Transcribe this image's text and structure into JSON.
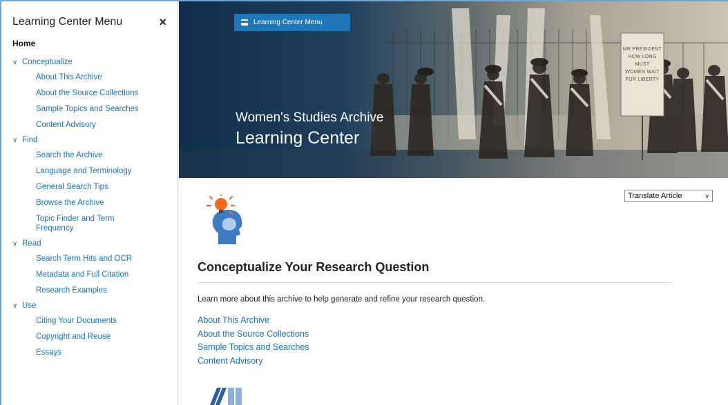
{
  "sidebar": {
    "title": "Learning Center Menu",
    "close_label": "×",
    "home_label": "Home",
    "sections": [
      {
        "label": "Conceptualize",
        "items": [
          "About This Archive",
          "About the Source Collections",
          "Sample Topics and Searches",
          "Content Advisory"
        ]
      },
      {
        "label": "Find",
        "items": [
          "Search the Archive",
          "Language and Terminology",
          "General Search Tips",
          "Browse the Archive",
          "Topic Finder and Term Frequency"
        ]
      },
      {
        "label": "Read",
        "items": [
          "Search Term Hits and OCR",
          "Metadata and Full Citation",
          "Research Examples"
        ]
      },
      {
        "label": "Use",
        "items": [
          "Citing Your Documents",
          "Copyright and Reuse",
          "Essays"
        ]
      }
    ]
  },
  "hero": {
    "menu_button_label": "Learning Center Menu",
    "subtitle": "Women's Studies Archive",
    "title": "Learning Center",
    "sign_text": [
      "MR PRESIDENT",
      "HOW LONG",
      "MUST",
      "WOMEN WAIT",
      "FOR LIBERTY"
    ]
  },
  "translate": {
    "selected": "Translate Article"
  },
  "main": {
    "section_title": "Conceptualize Your Research Question",
    "intro": "Learn more about this archive to help generate and refine your research question.",
    "links": [
      "About This Archive",
      "About the Source Collections",
      "Sample Topics and Searches",
      "Content Advisory"
    ]
  },
  "colors": {
    "link": "#1a73b8",
    "button": "#1f77b9",
    "hero_dark": "#0f2e4c"
  }
}
